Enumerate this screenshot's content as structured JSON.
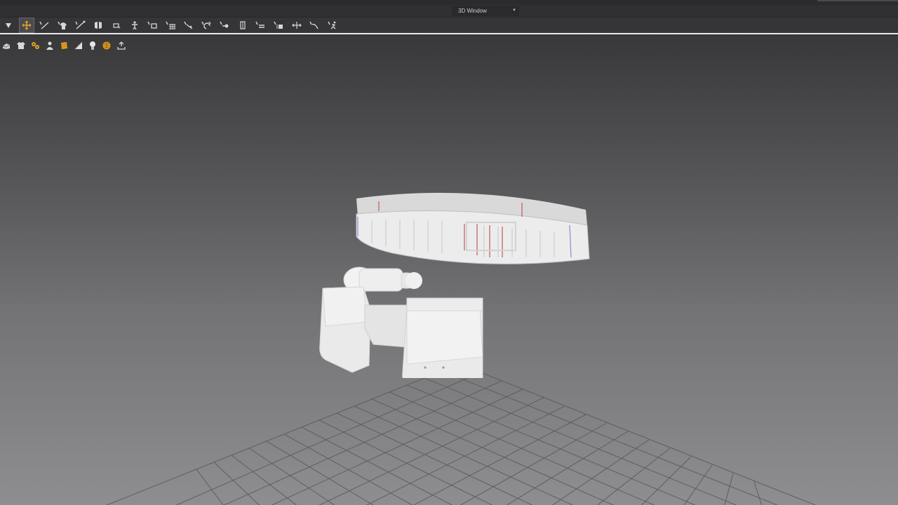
{
  "window": {
    "title": "3D Window",
    "title_dropdown_icon": "chevron-down-icon"
  },
  "toolbar": {
    "tools": [
      {
        "name": "select-mesh-icon",
        "active": false
      },
      {
        "name": "transform-pattern-icon",
        "active": true
      },
      {
        "name": "edit-pattern-icon",
        "active": false
      },
      {
        "name": "garment-fit-icon",
        "active": false
      },
      {
        "name": "edit-curvature-icon",
        "active": false
      },
      {
        "name": "tack-icon",
        "active": false
      },
      {
        "name": "fold-arrangement-icon",
        "active": false
      },
      {
        "name": "avatar-pose-icon",
        "active": false
      },
      {
        "name": "sewing-icon",
        "active": false
      },
      {
        "name": "mesh-grid-icon",
        "active": false
      },
      {
        "name": "measure-icon",
        "active": false
      },
      {
        "name": "pin-icon",
        "active": false
      },
      {
        "name": "trim-icon",
        "active": false
      },
      {
        "name": "button-icon",
        "active": false
      },
      {
        "name": "zipper-icon",
        "active": false
      },
      {
        "name": "topstitch-icon",
        "active": false
      },
      {
        "name": "puckering-icon",
        "active": false
      },
      {
        "name": "strap-icon",
        "active": false
      },
      {
        "name": "animation-icon",
        "active": false
      }
    ]
  },
  "viewport_toolbar": {
    "items": [
      {
        "name": "show-3d-garment-icon"
      },
      {
        "name": "garment-texture-icon"
      },
      {
        "name": "show-pins-icon"
      },
      {
        "name": "show-avatar-icon"
      },
      {
        "name": "avatar-texture-icon"
      },
      {
        "name": "render-style-icon"
      },
      {
        "name": "lighting-icon"
      },
      {
        "name": "environment-icon"
      },
      {
        "name": "export-icon"
      }
    ]
  },
  "colors": {
    "toolbar_bg": "#353538",
    "accent_active": "#e8a020",
    "viewport_top": "#38383b",
    "viewport_bottom": "#8e8e90",
    "grid_line": "#5a5a5c",
    "garment": "#e9e9e9"
  }
}
